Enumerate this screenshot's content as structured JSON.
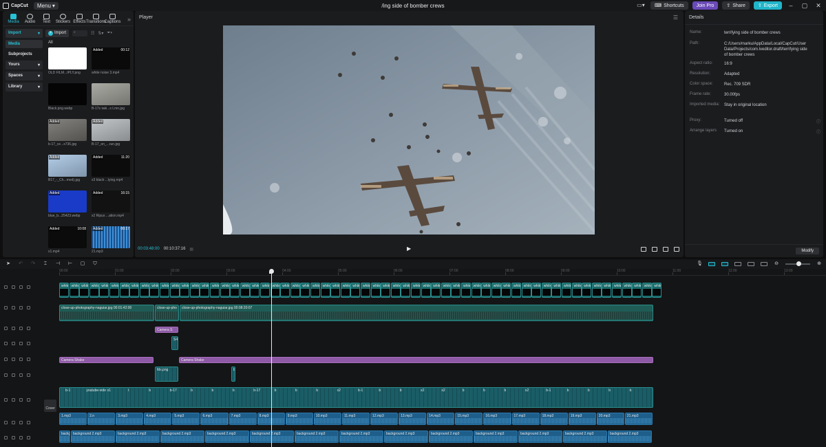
{
  "app": {
    "logo_text": "CapCut",
    "menu_label": "Menu",
    "project_title": "/ing side of bomber crews",
    "shortcuts_label": "Shortcuts",
    "join_pro_label": "Join Pro",
    "share_label": "Share",
    "export_label": "Export"
  },
  "media_tabs": [
    {
      "label": "Media",
      "icon": "media-icon"
    },
    {
      "label": "Audio",
      "icon": "audio-icon"
    },
    {
      "label": "Text",
      "icon": "text-icon"
    },
    {
      "label": "Stickers",
      "icon": "stickers-icon"
    },
    {
      "label": "Effects",
      "icon": "effects-icon"
    },
    {
      "label": "Transitions",
      "icon": "transitions-icon"
    },
    {
      "label": "Captions",
      "icon": "captions-icon"
    }
  ],
  "sidenav": {
    "import": "Import",
    "media": "Media",
    "subprojects": "Subprojects",
    "yours": "Yours",
    "spaces": "Spaces",
    "library": "Library"
  },
  "mediabar": {
    "import_label": "Import",
    "all_label": "All"
  },
  "media_items": [
    {
      "name": "OLD FILM...IPLY.png",
      "added": "",
      "duration": "",
      "bg": "#ffffff"
    },
    {
      "name": "white noise 3.mp4",
      "added": "Added",
      "duration": "00:12",
      "bg": "#0a0a0a"
    },
    {
      "name": "Black.png.webp",
      "added": "",
      "duration": "",
      "bg": "#050505"
    },
    {
      "name": "B-17s taki...s Lmn.jpg",
      "added": "",
      "duration": "",
      "bg": "#9a9c93"
    },
    {
      "name": "b-17_ce...x736.jpg",
      "added": "Added",
      "duration": "",
      "bg": "#6f6d69"
    },
    {
      "name": "B-17_on_...run.jpg",
      "added": "Added",
      "duration": "",
      "bg": "#b8bcbf"
    },
    {
      "name": "B17_-_Ch...med).jpg",
      "added": "Added",
      "duration": "",
      "bg": "#a8c6e4"
    },
    {
      "name": "x3 black ...lying.mp4",
      "added": "Added",
      "duration": "11:20",
      "bg": "#0c0c0c"
    },
    {
      "name": "blue_b...25423.webp",
      "added": "Added",
      "duration": "",
      "bg": "#1a3bc8"
    },
    {
      "name": "x2 Ripus ...ation.mp4",
      "added": "Added",
      "duration": "16:15",
      "bg": "#121212"
    },
    {
      "name": "x1.mp4",
      "added": "Added",
      "duration": "10:08",
      "bg": "#0b0b0b"
    },
    {
      "name": "21.mp3",
      "added": "Added",
      "duration": "00:17",
      "bg": "#2a6fb8"
    }
  ],
  "player": {
    "header": "Player",
    "time_current": "00:03:48:00",
    "time_total": "00:10:37:16"
  },
  "details": {
    "header": "Details",
    "rows": [
      {
        "label": "Name:",
        "value": "terrifying side of bomber crews"
      },
      {
        "label": "Path:",
        "value": "C:/Users/marku/AppData/Local/CapCut/User Data/Projects/com.lveditor.draft/terrifying side of bomber crews"
      },
      {
        "label": "Aspect ratio:",
        "value": "16:9"
      },
      {
        "label": "Resolution:",
        "value": "Adapted"
      },
      {
        "label": "Color space:",
        "value": "Rec. 709 SDR"
      },
      {
        "label": "Frame rate:",
        "value": "30.00fps"
      },
      {
        "label": "Imported media:",
        "value": "Stay in original location"
      },
      {
        "label": "Proxy:",
        "value": "Turned off"
      },
      {
        "label": "Arrange layers",
        "value": "Turned on"
      }
    ],
    "modify_label": "Modify"
  },
  "timeline": {
    "ruler_ticks": [
      "00:00",
      "01:00",
      "02:00",
      "03:00",
      "04:00",
      "05:00",
      "06:00",
      "07:00",
      "08:00",
      "09:00",
      "10:00",
      "11:00",
      "12:00",
      "13:00"
    ],
    "cover_label": "Cover",
    "white_label": "white",
    "photo_clips": [
      {
        "label": "close-up-photography-naguiar.jpg 00:01:42:00"
      },
      {
        "label": "close-up-pho"
      },
      {
        "label": "close-up-photography-naguiar.jpg 00:08:20:07"
      }
    ],
    "effect_small": "Camera S",
    "effect_clip_a": "Camera Shake",
    "effect_clip_b": "Camera Shake",
    "overlay_small": "S4",
    "overlay_file": "fds.png",
    "overlay_b": "b",
    "main_labels": [
      "b-1",
      "youtube-vide",
      "x1",
      "t",
      "b",
      "b-17",
      "b",
      "b",
      "b",
      "b-17",
      "b",
      "b",
      "b",
      "x2",
      "b-1",
      "b",
      "b",
      "x2",
      "x2",
      "b",
      "b",
      "b",
      "x2",
      "b-1",
      "b",
      "b",
      "b",
      "b"
    ],
    "audio_row1": [
      "1.mp3",
      "2.n",
      "3.mp3",
      "4.mp3",
      "5.mp3",
      "6.mp3",
      "7.mp3",
      "8.mp3",
      "9.mp3",
      "10.mp3",
      "11.mp3",
      "12.mp3",
      "13.mp3",
      "14.mp3",
      "15.mp3",
      "16.mp3",
      "17.mp3",
      "18.mp3",
      "19.mp3",
      "20.mp3",
      "21.mp3"
    ],
    "audio_row2_first": "backg",
    "audio_row2": "background 2.mp3"
  }
}
